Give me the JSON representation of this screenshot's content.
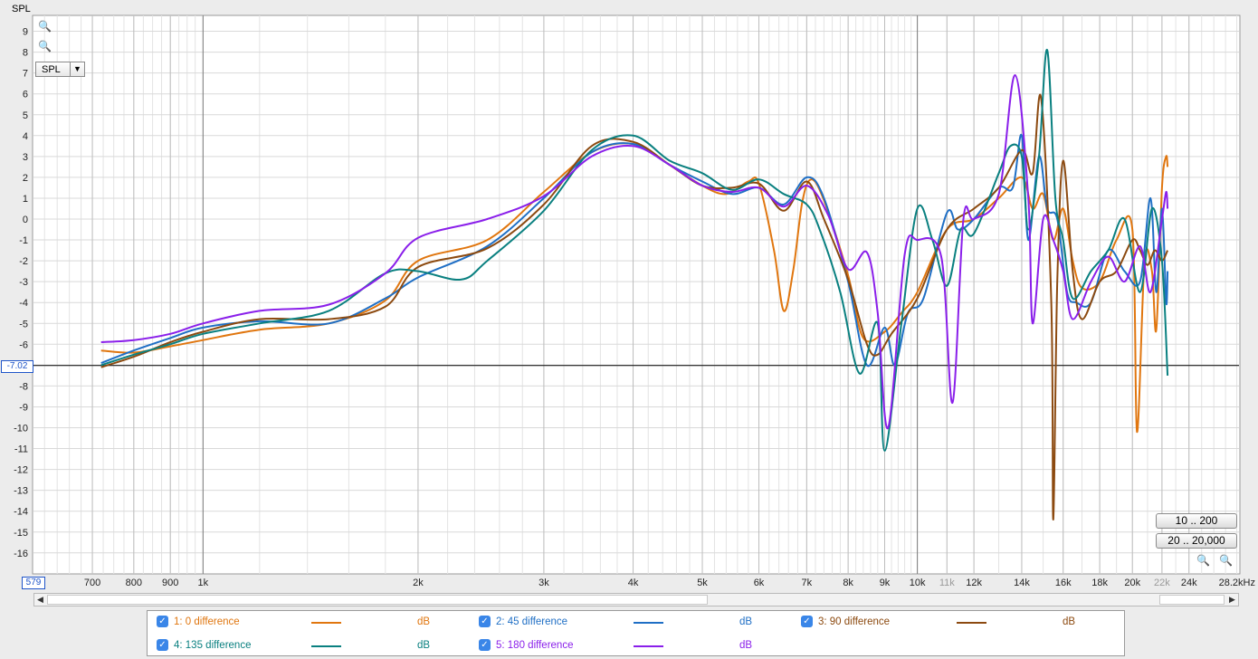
{
  "chart_data": {
    "type": "line",
    "ylabel": "SPL",
    "x_unit": "Hz",
    "xscale": "log",
    "xlim": [
      579,
      28200
    ],
    "ylim": [
      -17,
      9.8
    ],
    "grid": true,
    "y_ticks": [
      9,
      8,
      7,
      6,
      5,
      4,
      3,
      2,
      1,
      0,
      -1,
      -2,
      -3,
      -4,
      -5,
      -6,
      -8,
      -9,
      -10,
      -11,
      -12,
      -13,
      -14,
      -15,
      -16
    ],
    "x_ticks": [
      {
        "value": 700,
        "label": "700"
      },
      {
        "value": 800,
        "label": "800"
      },
      {
        "value": 900,
        "label": "900"
      },
      {
        "value": 1000,
        "label": "1k"
      },
      {
        "value": 2000,
        "label": "2k"
      },
      {
        "value": 3000,
        "label": "3k"
      },
      {
        "value": 4000,
        "label": "4k"
      },
      {
        "value": 5000,
        "label": "5k"
      },
      {
        "value": 6000,
        "label": "6k"
      },
      {
        "value": 7000,
        "label": "7k"
      },
      {
        "value": 8000,
        "label": "8k"
      },
      {
        "value": 9000,
        "label": "9k"
      },
      {
        "value": 10000,
        "label": "10k"
      },
      {
        "value": 11000,
        "label": "11k",
        "dim": true
      },
      {
        "value": 12000,
        "label": "12k"
      },
      {
        "value": 14000,
        "label": "14k"
      },
      {
        "value": 16000,
        "label": "16k"
      },
      {
        "value": 18000,
        "label": "18k"
      },
      {
        "value": 20000,
        "label": "20k"
      },
      {
        "value": 22000,
        "label": "22k",
        "dim": true
      },
      {
        "value": 24000,
        "label": "24k"
      },
      {
        "value": 28200,
        "label": "28.2kHz"
      }
    ],
    "cursor": {
      "y_value": -7.02,
      "y_label": "-7.02",
      "x_label": "579"
    },
    "series": [
      {
        "name": "1: 0 difference",
        "unit": "dB",
        "color": "#e0760f",
        "points": [
          [
            720,
            -6.3
          ],
          [
            800,
            -6.4
          ],
          [
            900,
            -6.1
          ],
          [
            1000,
            -5.8
          ],
          [
            1200,
            -5.3
          ],
          [
            1500,
            -5.0
          ],
          [
            1800,
            -3.9
          ],
          [
            2000,
            -2.0
          ],
          [
            2500,
            -1.0
          ],
          [
            3000,
            1.3
          ],
          [
            3500,
            3.2
          ],
          [
            4000,
            3.6
          ],
          [
            4500,
            2.6
          ],
          [
            5000,
            1.6
          ],
          [
            5400,
            1.2
          ],
          [
            5800,
            1.8
          ],
          [
            6000,
            1.7
          ],
          [
            6300,
            -1.5
          ],
          [
            6500,
            -4.4
          ],
          [
            6700,
            -2.5
          ],
          [
            6900,
            0.8
          ],
          [
            7100,
            1.9
          ],
          [
            7400,
            0.9
          ],
          [
            8000,
            -2.7
          ],
          [
            8400,
            -5.7
          ],
          [
            9000,
            -5.4
          ],
          [
            9500,
            -4.5
          ],
          [
            10000,
            -3.5
          ],
          [
            11000,
            -0.5
          ],
          [
            12000,
            0.0
          ],
          [
            13000,
            1.0
          ],
          [
            14000,
            2.0
          ],
          [
            14500,
            0.5
          ],
          [
            15000,
            1.2
          ],
          [
            15500,
            -1.0
          ],
          [
            16000,
            0.5
          ],
          [
            16500,
            -2.0
          ],
          [
            17000,
            -3.3
          ],
          [
            18000,
            -3.0
          ],
          [
            19000,
            -1.0
          ],
          [
            20000,
            -0.5
          ],
          [
            20300,
            -10.2
          ],
          [
            20800,
            -2.0
          ],
          [
            21300,
            -2.5
          ],
          [
            21600,
            -5.3
          ],
          [
            22000,
            1.5
          ],
          [
            22300,
            3.0
          ],
          [
            22400,
            2.5
          ]
        ]
      },
      {
        "name": "2: 45 difference",
        "unit": "dB",
        "color": "#1f6fc5",
        "points": [
          [
            720,
            -6.9
          ],
          [
            800,
            -6.3
          ],
          [
            900,
            -5.7
          ],
          [
            1000,
            -5.2
          ],
          [
            1200,
            -4.9
          ],
          [
            1500,
            -5.0
          ],
          [
            1800,
            -3.8
          ],
          [
            2000,
            -2.8
          ],
          [
            2500,
            -1.3
          ],
          [
            3000,
            1.0
          ],
          [
            3500,
            3.2
          ],
          [
            4000,
            3.6
          ],
          [
            4500,
            2.6
          ],
          [
            5000,
            1.8
          ],
          [
            5500,
            1.2
          ],
          [
            6000,
            1.5
          ],
          [
            6500,
            0.7
          ],
          [
            7000,
            2.0
          ],
          [
            7400,
            1.0
          ],
          [
            8000,
            -3.0
          ],
          [
            8500,
            -7.0
          ],
          [
            9000,
            -5.2
          ],
          [
            9300,
            -7.0
          ],
          [
            9700,
            -4.5
          ],
          [
            10200,
            -3.8
          ],
          [
            11000,
            0.3
          ],
          [
            11400,
            -0.5
          ],
          [
            12000,
            0.0
          ],
          [
            13000,
            1.5
          ],
          [
            13600,
            1.5
          ],
          [
            14000,
            4.0
          ],
          [
            14300,
            -1.0
          ],
          [
            14800,
            3.0
          ],
          [
            15200,
            0.5
          ],
          [
            15700,
            0.0
          ],
          [
            16200,
            -3.5
          ],
          [
            16700,
            -4.0
          ],
          [
            17500,
            -4.0
          ],
          [
            18500,
            -1.5
          ],
          [
            19500,
            -2.5
          ],
          [
            20500,
            -3.0
          ],
          [
            21200,
            1.0
          ],
          [
            21600,
            -3.5
          ],
          [
            22000,
            0.5
          ],
          [
            22300,
            -4.0
          ],
          [
            22400,
            -2.5
          ]
        ]
      },
      {
        "name": "3: 90 difference",
        "unit": "dB",
        "color": "#8c4a10",
        "points": [
          [
            720,
            -7.1
          ],
          [
            800,
            -6.6
          ],
          [
            900,
            -5.9
          ],
          [
            1000,
            -5.4
          ],
          [
            1200,
            -4.8
          ],
          [
            1500,
            -4.8
          ],
          [
            1800,
            -4.2
          ],
          [
            2000,
            -2.3
          ],
          [
            2500,
            -1.4
          ],
          [
            3000,
            0.7
          ],
          [
            3500,
            3.5
          ],
          [
            4000,
            3.7
          ],
          [
            4500,
            2.6
          ],
          [
            5000,
            1.6
          ],
          [
            5500,
            1.5
          ],
          [
            6000,
            1.7
          ],
          [
            6500,
            0.4
          ],
          [
            7000,
            1.8
          ],
          [
            7400,
            0.0
          ],
          [
            8000,
            -2.9
          ],
          [
            8500,
            -6.0
          ],
          [
            8800,
            -6.5
          ],
          [
            9200,
            -5.5
          ],
          [
            10000,
            -3.8
          ],
          [
            11000,
            -0.5
          ],
          [
            12000,
            0.5
          ],
          [
            13000,
            1.5
          ],
          [
            14000,
            3.3
          ],
          [
            14500,
            2.2
          ],
          [
            14900,
            5.8
          ],
          [
            15400,
            -4.0
          ],
          [
            15500,
            -14.4
          ],
          [
            15700,
            -3.0
          ],
          [
            16000,
            2.8
          ],
          [
            16500,
            -2.5
          ],
          [
            17000,
            -4.8
          ],
          [
            18000,
            -3.0
          ],
          [
            19000,
            -2.5
          ],
          [
            20000,
            -1.0
          ],
          [
            20500,
            -1.5
          ],
          [
            21000,
            -2.2
          ],
          [
            21500,
            -1.5
          ],
          [
            22000,
            -2.0
          ],
          [
            22400,
            -1.5
          ]
        ]
      },
      {
        "name": "4: 135 difference",
        "unit": "dB",
        "color": "#0a8080",
        "points": [
          [
            720,
            -7.0
          ],
          [
            800,
            -6.5
          ],
          [
            900,
            -6.0
          ],
          [
            1000,
            -5.5
          ],
          [
            1200,
            -5.0
          ],
          [
            1500,
            -4.4
          ],
          [
            1800,
            -2.6
          ],
          [
            2000,
            -2.5
          ],
          [
            2300,
            -2.9
          ],
          [
            2500,
            -2.0
          ],
          [
            3000,
            0.4
          ],
          [
            3500,
            3.3
          ],
          [
            4000,
            4.0
          ],
          [
            4500,
            2.8
          ],
          [
            5000,
            2.2
          ],
          [
            5500,
            1.4
          ],
          [
            6000,
            1.9
          ],
          [
            6500,
            1.2
          ],
          [
            7000,
            0.7
          ],
          [
            7300,
            -0.5
          ],
          [
            7800,
            -3.5
          ],
          [
            8300,
            -7.4
          ],
          [
            8800,
            -5.0
          ],
          [
            9000,
            -11.1
          ],
          [
            9500,
            -5.0
          ],
          [
            10000,
            0.5
          ],
          [
            10500,
            -1.0
          ],
          [
            11000,
            -3.2
          ],
          [
            11500,
            -0.5
          ],
          [
            12000,
            -0.7
          ],
          [
            13000,
            2.2
          ],
          [
            13500,
            3.5
          ],
          [
            14000,
            3.0
          ],
          [
            14300,
            -0.5
          ],
          [
            14800,
            3.0
          ],
          [
            15200,
            8.1
          ],
          [
            15600,
            1.0
          ],
          [
            16000,
            -1.0
          ],
          [
            16500,
            -3.8
          ],
          [
            17500,
            -2.5
          ],
          [
            18500,
            -1.5
          ],
          [
            19500,
            0.0
          ],
          [
            20500,
            -3.5
          ],
          [
            21300,
            0.5
          ],
          [
            22000,
            -2.0
          ],
          [
            22400,
            -7.5
          ]
        ]
      },
      {
        "name": "5: 180 difference",
        "unit": "dB",
        "color": "#8a1fea",
        "points": [
          [
            720,
            -5.9
          ],
          [
            800,
            -5.8
          ],
          [
            900,
            -5.5
          ],
          [
            1000,
            -5.0
          ],
          [
            1200,
            -4.4
          ],
          [
            1500,
            -4.1
          ],
          [
            1800,
            -2.6
          ],
          [
            2000,
            -0.9
          ],
          [
            2500,
            0.0
          ],
          [
            3000,
            1.1
          ],
          [
            3500,
            3.0
          ],
          [
            4000,
            3.5
          ],
          [
            4500,
            2.6
          ],
          [
            5000,
            1.6
          ],
          [
            5500,
            1.3
          ],
          [
            6000,
            1.5
          ],
          [
            6500,
            0.6
          ],
          [
            7000,
            1.6
          ],
          [
            7500,
            0.2
          ],
          [
            8000,
            -2.4
          ],
          [
            8500,
            -1.6
          ],
          [
            8800,
            -4.5
          ],
          [
            9100,
            -10.0
          ],
          [
            9600,
            -1.7
          ],
          [
            10000,
            -1.0
          ],
          [
            10800,
            -1.8
          ],
          [
            11200,
            -8.8
          ],
          [
            11600,
            0.0
          ],
          [
            12000,
            0.0
          ],
          [
            13000,
            1.2
          ],
          [
            13700,
            6.9
          ],
          [
            14300,
            1.0
          ],
          [
            14500,
            -5.0
          ],
          [
            15000,
            0.0
          ],
          [
            15500,
            -1.0
          ],
          [
            16000,
            -2.5
          ],
          [
            16500,
            -4.8
          ],
          [
            17500,
            -3.0
          ],
          [
            18500,
            -1.8
          ],
          [
            19500,
            -3.0
          ],
          [
            20500,
            -1.3
          ],
          [
            21200,
            -3.5
          ],
          [
            22000,
            0.0
          ],
          [
            22300,
            1.3
          ],
          [
            22400,
            0.5
          ]
        ]
      }
    ]
  },
  "toolbar": {
    "select_value": "SPL",
    "range_button_1": "10 .. 200",
    "range_button_2": "20 .. 20,000"
  }
}
